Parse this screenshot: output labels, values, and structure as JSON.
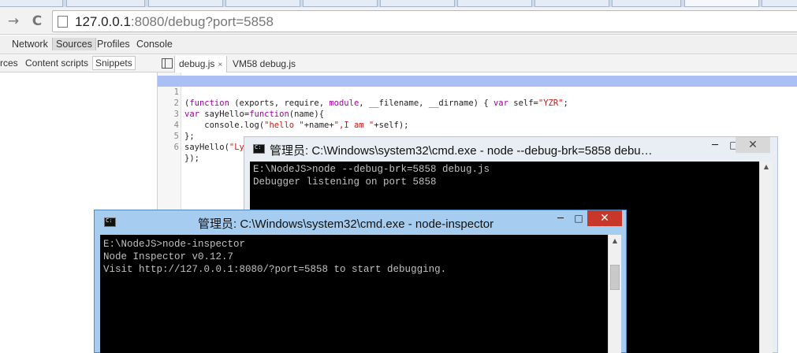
{
  "browser": {
    "nav": {
      "back_glyph": "→",
      "reload_glyph": "C"
    },
    "url": {
      "host": "127.0.0.1",
      "rest": ":8080/debug?port=5858"
    }
  },
  "devtools": {
    "panels": [
      "Network",
      "Sources",
      "Profiles",
      "Console"
    ],
    "selected_panel": "Sources",
    "navigator_tabs": [
      "rces",
      "Content scripts",
      "Snippets"
    ],
    "selected_navigator_tab": "Snippets",
    "open_files": [
      {
        "label": "debug.js",
        "close": "×"
      },
      {
        "label": "VM58 debug.js"
      }
    ]
  },
  "editor": {
    "lines": [
      {
        "n": "1",
        "text": "(function (exports, require, module, __filename, __dirname) { var self=\"YZR\";"
      },
      {
        "n": "2",
        "text": "var sayHello=function(name){"
      },
      {
        "n": "3",
        "text": "    console.log(\"hello \"+name+\",I am \"+self);"
      },
      {
        "n": "4",
        "text": "};"
      },
      {
        "n": "5",
        "text": "sayHello(\"Lyf\");"
      },
      {
        "n": "6",
        "text": "});"
      }
    ],
    "highlighted_line": 1
  },
  "windows": {
    "debug": {
      "title": "管理员: C:\\Windows\\system32\\cmd.exe - node  --debug-brk=5858 debu…",
      "min": "─",
      "max": "□",
      "close": "✕",
      "lines": [
        "E:\\NodeJS>node --debug-brk=5858 debug.js",
        "Debugger listening on port 5858"
      ]
    },
    "inspector": {
      "title": "管理员: C:\\Windows\\system32\\cmd.exe - node-inspector",
      "min": "─",
      "max": "□",
      "close": "✕",
      "lines": [
        "E:\\NodeJS>node-inspector",
        "Node Inspector v0.12.7",
        "Visit http://127.0.0.1:8080/?port=5858 to start debugging."
      ]
    }
  },
  "colors": {
    "highlight": "#aac0f5",
    "keyword": "#a000a0",
    "string": "#c41a16",
    "inactive_frame": "#e9eef4",
    "active_frame": "#a6cdf0",
    "close_button": "#c7372a",
    "console_bg": "#000000",
    "console_fg": "#c0c0c0"
  }
}
